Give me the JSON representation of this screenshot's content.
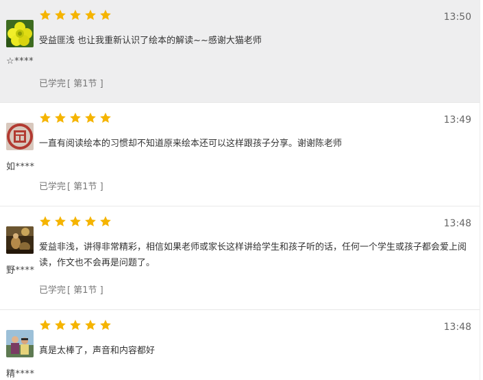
{
  "star_color": "#f5b400",
  "reviews": [
    {
      "rating": 5,
      "time": "13:50",
      "text": "受益匪浅 也让我重新认识了绘本的解读~~感谢大猫老师",
      "user": "☆****",
      "status": "已学完",
      "section": "第1节",
      "avatar": "yellow-flower-avatar"
    },
    {
      "rating": 5,
      "time": "13:49",
      "text": "一直有阅读绘本的习惯却不知道原来绘本还可以这样跟孩子分享。谢谢陈老师",
      "user": "如****",
      "status": "已学完",
      "section": "第1节",
      "avatar": "red-seal-avatar"
    },
    {
      "rating": 5,
      "time": "13:48",
      "text": "爱益非浅，讲得非常精彩，相信如果老师或家长这样讲给学生和孩子听的话，任何一个学生或孩子都会爱上阅读，作文也不会再是问题了。",
      "user": "野****",
      "status": "已学完",
      "section": "第1节",
      "avatar": "painting-avatar"
    },
    {
      "rating": 5,
      "time": "13:48",
      "text": "真是太棒了，声音和内容都好",
      "user": "精****",
      "status": "",
      "section": "",
      "avatar": "couple-photo-avatar"
    }
  ]
}
